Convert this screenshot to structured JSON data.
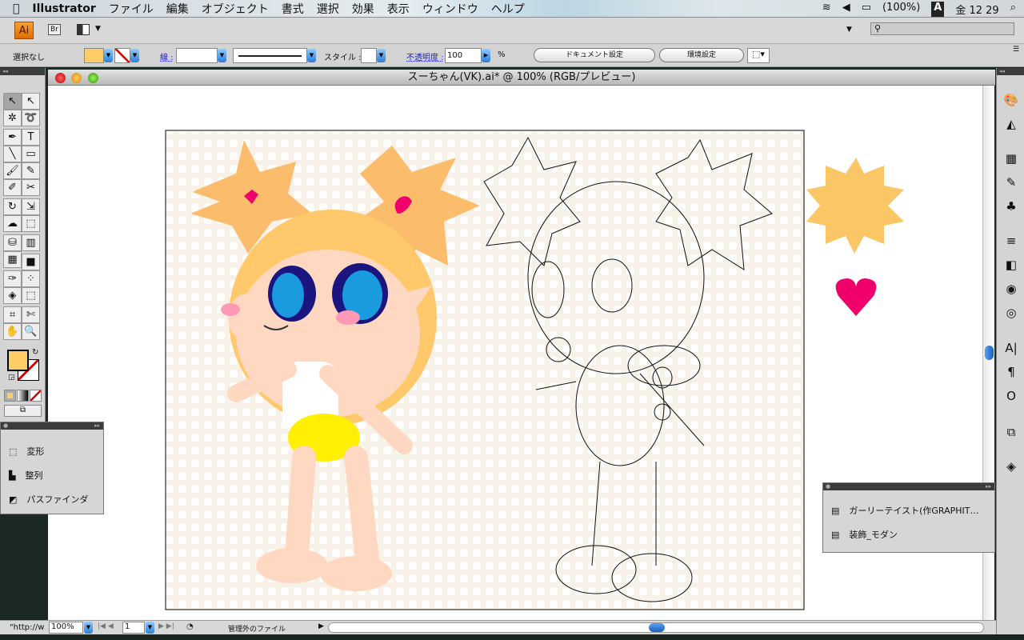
{
  "menubar": {
    "app": "Illustrator",
    "items": [
      "ファイル",
      "編集",
      "オブジェクト",
      "書式",
      "選択",
      "効果",
      "表示",
      "ウィンドウ",
      "ヘルプ"
    ],
    "battery": "(100%)",
    "input_method": "A",
    "clock": "金 12 29"
  },
  "appbar": {
    "logo": "Ai",
    "bridge": "Br",
    "search_placeholder": ""
  },
  "control": {
    "selection": "選択なし",
    "fill_color": "#ffcc66",
    "stroke_label": "線 :",
    "style_label": "スタイル :",
    "opacity_label": "不透明度 :",
    "opacity_value": "100",
    "percent": "%",
    "doc_setup": "ドキュメント設定",
    "prefs": "環境設定"
  },
  "document": {
    "title": "スーちゃん(VK).ai* @ 100% (RGB/プレビュー)"
  },
  "tools": [
    [
      "selection-icon",
      "↖"
    ],
    [
      "direct-selection-icon",
      "↖"
    ],
    [
      "magic-wand-icon",
      "✲"
    ],
    [
      "lasso-icon",
      "➰"
    ],
    [
      "pen-icon",
      "✒"
    ],
    [
      "type-icon",
      "T"
    ],
    [
      "line-icon",
      "╲"
    ],
    [
      "rectangle-icon",
      "▭"
    ],
    [
      "paintbrush-icon",
      "🖌"
    ],
    [
      "pencil-icon",
      "✎"
    ],
    [
      "blob-brush-icon",
      "✐"
    ],
    [
      "scissors-icon",
      "✂"
    ],
    [
      "rotate-icon",
      "↻"
    ],
    [
      "scale-icon",
      "⇲"
    ],
    [
      "warp-icon",
      "☁"
    ],
    [
      "free-transform-icon",
      "⬚"
    ],
    [
      "symbol-sprayer-icon",
      "⛁"
    ],
    [
      "graph-icon",
      "▥"
    ],
    [
      "mesh-icon",
      "▦"
    ],
    [
      "gradient-icon",
      "■"
    ],
    [
      "eyedropper-icon",
      "✑"
    ],
    [
      "blend-icon",
      "⁘"
    ],
    [
      "live-paint-icon",
      "◈"
    ],
    [
      "live-paint-selection-icon",
      "⬚"
    ],
    [
      "crop-icon",
      "⌗"
    ],
    [
      "slice-icon",
      "✄"
    ],
    [
      "hand-icon",
      "✋"
    ],
    [
      "zoom-icon",
      "🔍"
    ]
  ],
  "panel_left": {
    "items": [
      "変形",
      "整列",
      "パスファインダ"
    ]
  },
  "panel_right": {
    "items": [
      "ガーリーテイスト(作GRAPHIT…",
      "装飾_モダン"
    ]
  },
  "status": {
    "url": "\"http://w",
    "zoom": "100%",
    "page": "1",
    "file_status": "管理外のファイル"
  }
}
